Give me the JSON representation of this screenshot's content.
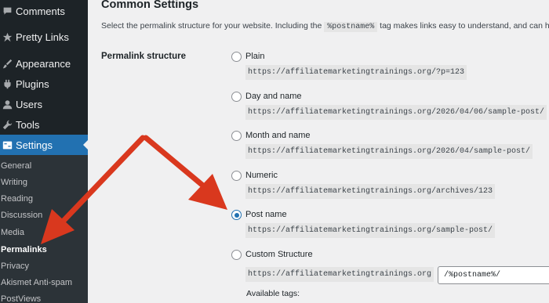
{
  "sidebar": {
    "items": [
      {
        "label": "Comments",
        "icon": "comments-icon"
      },
      {
        "label": "Pretty Links",
        "icon": "link-icon"
      },
      {
        "label": "Appearance",
        "icon": "brush-icon"
      },
      {
        "label": "Plugins",
        "icon": "plugin-icon"
      },
      {
        "label": "Users",
        "icon": "user-icon"
      },
      {
        "label": "Tools",
        "icon": "wrench-icon"
      },
      {
        "label": "Settings",
        "icon": "settings-icon",
        "active": true
      }
    ],
    "submenu": [
      {
        "label": "General"
      },
      {
        "label": "Writing"
      },
      {
        "label": "Reading"
      },
      {
        "label": "Discussion"
      },
      {
        "label": "Media"
      },
      {
        "label": "Permalinks",
        "current": true
      },
      {
        "label": "Privacy"
      },
      {
        "label": "Akismet Anti-spam"
      },
      {
        "label": "PostViews"
      }
    ]
  },
  "main": {
    "title": "Common Settings",
    "description_before": "Select the permalink structure for your website. Including the",
    "description_tag": "%postname%",
    "description_after": "tag makes links easy to understand, and can hel",
    "field_label": "Permalink structure",
    "options": [
      {
        "label": "Plain",
        "url": "https://affiliatemarketingtrainings.org/?p=123",
        "checked": false
      },
      {
        "label": "Day and name",
        "url": "https://affiliatemarketingtrainings.org/2026/04/06/sample-post/",
        "checked": false
      },
      {
        "label": "Month and name",
        "url": "https://affiliatemarketingtrainings.org/2026/04/sample-post/",
        "checked": false
      },
      {
        "label": "Numeric",
        "url": "https://affiliatemarketingtrainings.org/archives/123",
        "checked": false
      },
      {
        "label": "Post name",
        "url": "https://affiliatemarketingtrainings.org/sample-post/",
        "checked": true
      },
      {
        "label": "Custom Structure",
        "url": "https://affiliatemarketingtrainings.org",
        "checked": false
      }
    ],
    "custom_value": "/%postname%/",
    "available_tags": "Available tags:"
  },
  "colors": {
    "sidebar_bg": "#1d2327",
    "submenu_bg": "#2c3338",
    "accent": "#2271b1",
    "arrow": "#d9381e"
  }
}
